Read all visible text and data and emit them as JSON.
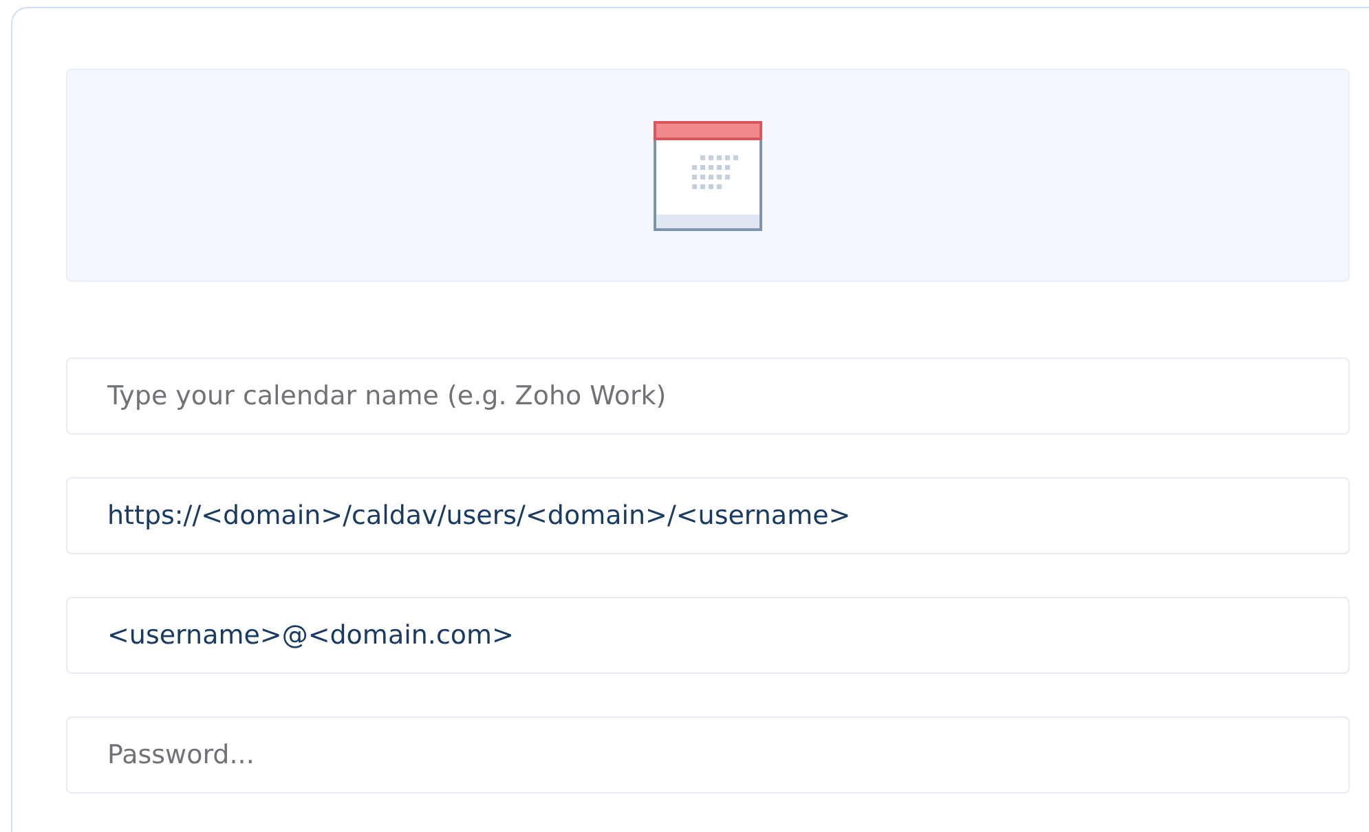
{
  "fields": [
    {
      "placeholder": "Type your calendar name (e.g. Zoho Work)"
    },
    {
      "value": "https://<domain>/caldav/users/<domain>/<username>"
    },
    {
      "value": "<username>@<domain.com>"
    },
    {
      "placeholder": "Password..."
    }
  ]
}
